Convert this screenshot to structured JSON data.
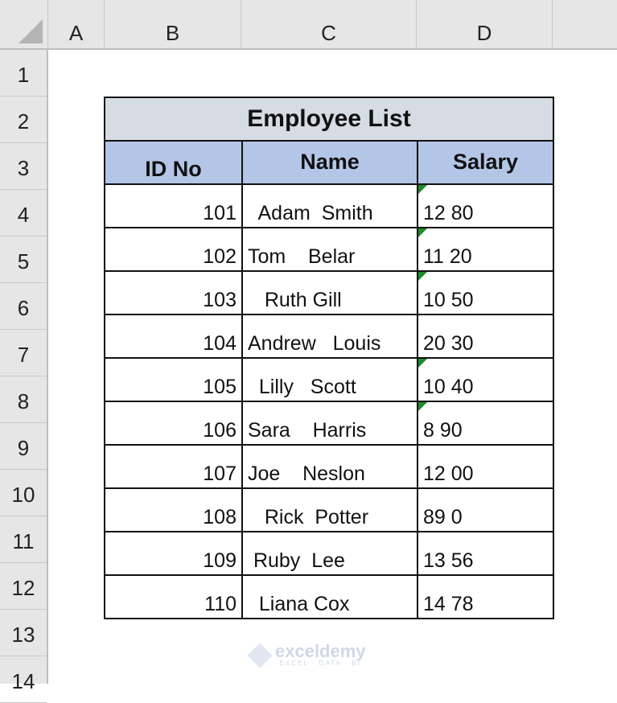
{
  "column_headers": [
    "A",
    "B",
    "C",
    "D"
  ],
  "row_headers": [
    "1",
    "2",
    "3",
    "4",
    "5",
    "6",
    "7",
    "8",
    "9",
    "10",
    "11",
    "12",
    "13",
    "14"
  ],
  "table": {
    "title": "Employee List",
    "headers": [
      "ID No",
      "Name",
      "Salary"
    ],
    "rows": [
      {
        "id": "101",
        "name": "  Adam  Smith",
        "salary": "12 80",
        "error_flag": true
      },
      {
        "id": "102",
        "name": "Tom    Belar",
        "salary": "11 20",
        "error_flag": true
      },
      {
        "id": "103",
        "name": "   Ruth Gill",
        "salary": "10 50",
        "error_flag": true
      },
      {
        "id": "104",
        "name": "Andrew   Louis",
        "salary": "20 30",
        "error_flag": false
      },
      {
        "id": "105",
        "name": "  Lilly   Scott",
        "salary": "10 40",
        "error_flag": true
      },
      {
        "id": "106",
        "name": "Sara    Harris",
        "salary": "8 90",
        "error_flag": true
      },
      {
        "id": "107",
        "name": "Joe    Neslon",
        "salary": "12 00",
        "error_flag": false
      },
      {
        "id": "108",
        "name": "   Rick  Potter",
        "salary": "89 0",
        "error_flag": false
      },
      {
        "id": "109",
        "name": " Ruby  Lee",
        "salary": "13 56",
        "error_flag": false
      },
      {
        "id": "110",
        "name": "  Liana Cox",
        "salary": "14 78",
        "error_flag": false
      }
    ]
  },
  "colors": {
    "title_fill": "#d6dce4",
    "header_fill": "#b4c6e7",
    "error_indicator": "#1e8a2a"
  },
  "watermark": {
    "name": "exceldemy",
    "tagline": "EXCEL · DATA · BI"
  }
}
